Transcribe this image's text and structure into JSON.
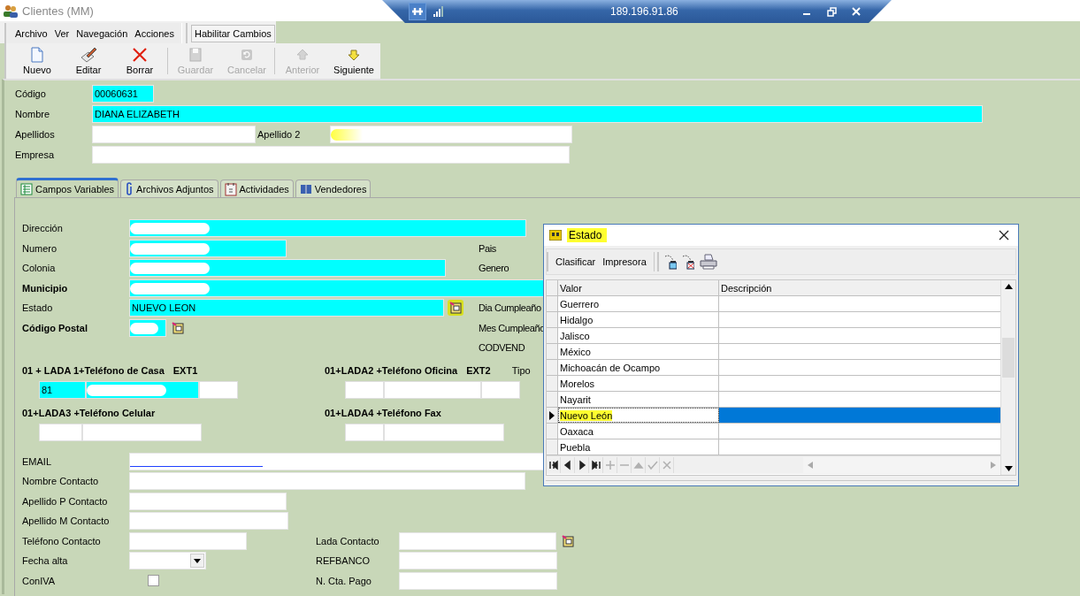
{
  "window": {
    "title": "Clientes (MM)"
  },
  "remote_bar": {
    "host": "189.196.91.86"
  },
  "menu": [
    "Archivo",
    "Ver",
    "Navegación",
    "Acciones"
  ],
  "enable_changes_button": "Habilitar Cambios",
  "toolbar": [
    {
      "label": "Nuevo",
      "disabled": false
    },
    {
      "label": "Editar",
      "disabled": false
    },
    {
      "label": "Borrar",
      "disabled": false
    },
    {
      "label": "Guardar",
      "disabled": true
    },
    {
      "label": "Cancelar",
      "disabled": true
    },
    {
      "label": "Anterior",
      "disabled": true
    },
    {
      "label": "Siguiente",
      "disabled": false
    }
  ],
  "header_fields": {
    "codigo": {
      "label": "Código",
      "value": "00060631",
      "highlighted": true
    },
    "nombre": {
      "label": "Nombre",
      "value": "DIANA ELIZABETH",
      "highlighted": true
    },
    "apellidos": {
      "label": "Apellidos",
      "second_label": "Apellido 2",
      "second_redacted": true
    },
    "empresa": {
      "label": "Empresa"
    }
  },
  "tabs": [
    {
      "label": "Campos Variables",
      "selected": true
    },
    {
      "label": "Archivos Adjuntos",
      "selected": false
    },
    {
      "label": "Actividades",
      "selected": false
    },
    {
      "label": "Vendedores",
      "selected": false
    }
  ],
  "address_fields": [
    {
      "label": "Dirección",
      "bold": false,
      "highlighted": true,
      "redacted": true,
      "lookup": false
    },
    {
      "label": "Numero",
      "bold": false,
      "highlighted": true,
      "redacted": true,
      "lookup": false
    },
    {
      "label": "Colonia",
      "bold": false,
      "highlighted": true,
      "redacted": true,
      "lookup": false
    },
    {
      "label": "Municipio",
      "bold": true,
      "highlighted": true,
      "redacted": true,
      "lookup": false
    },
    {
      "label": "Estado",
      "bold": false,
      "highlighted": true,
      "redacted": false,
      "value": "NUEVO LEON",
      "lookup": true,
      "lookup_highlighted": true
    },
    {
      "label": "Código Postal",
      "bold": true,
      "highlighted": true,
      "redacted": true,
      "lookup": true,
      "lookup_highlighted": false
    }
  ],
  "side_labels": [
    "Pais",
    "Genero",
    "Dia Cumpleaño",
    "Mes Cumpleaño",
    "CODVEND"
  ],
  "phone_groups": [
    {
      "labels": [
        "01 + LADA 1+Teléfono de Casa",
        "EXT1"
      ],
      "fields": [
        {
          "value": "81",
          "highlighted": true,
          "redacted": false
        },
        {
          "highlighted": true,
          "redacted": true
        },
        {
          "highlighted": false,
          "redacted": false
        }
      ]
    },
    {
      "labels": [
        "01+LADA2 +Teléfono Oficina",
        "EXT2",
        "Tipo"
      ],
      "fields": [
        {
          "highlighted": false,
          "redacted": false
        },
        {
          "highlighted": false,
          "redacted": false
        },
        {
          "highlighted": false,
          "redacted": false
        }
      ]
    },
    {
      "labels": [
        "01+LADA3 +Teléfono Celular"
      ],
      "fields": [
        {
          "highlighted": false,
          "redacted": false
        },
        {
          "highlighted": false,
          "redacted": false
        }
      ]
    },
    {
      "labels": [
        "01+LADA4  +Teléfono Fax"
      ],
      "fields": [
        {
          "highlighted": false,
          "redacted": false
        },
        {
          "highlighted": false,
          "redacted": false
        }
      ]
    }
  ],
  "contact_fields": [
    {
      "label": "EMAIL",
      "kind": "text",
      "redacted": true
    },
    {
      "label": "Nombre Contacto",
      "kind": "text",
      "redacted": false
    },
    {
      "label": "Apellido P Contacto",
      "kind": "text",
      "redacted": false
    },
    {
      "label": "Apellido M Contacto",
      "kind": "text",
      "redacted": false
    },
    {
      "label": "Teléfono Contacto",
      "kind": "text",
      "redacted": false
    },
    {
      "label": "Fecha alta",
      "kind": "dropdown"
    },
    {
      "label": "ConIVA",
      "kind": "checkbox",
      "checked": false
    }
  ],
  "bank_fields": [
    {
      "label": "Lada Contacto",
      "lookup": true
    },
    {
      "label": "REFBANCO",
      "lookup": false
    },
    {
      "label": "N. Cta. Pago",
      "lookup": false
    }
  ],
  "dialog": {
    "title": "Estado",
    "title_highlighted": true,
    "menu": [
      "Clasificar",
      "Impresora"
    ],
    "columns": [
      "Valor",
      "Descripción"
    ],
    "rows": [
      {
        "valor": "Guerrero",
        "selected": false,
        "highlighted": false
      },
      {
        "valor": "Hidalgo",
        "selected": false,
        "highlighted": false
      },
      {
        "valor": "Jalisco",
        "selected": false,
        "highlighted": false
      },
      {
        "valor": "México",
        "selected": false,
        "highlighted": false
      },
      {
        "valor": "Michoacán de Ocampo",
        "selected": false,
        "highlighted": false
      },
      {
        "valor": "Morelos",
        "selected": false,
        "highlighted": false
      },
      {
        "valor": "Nayarit",
        "selected": false,
        "highlighted": false
      },
      {
        "valor": "Nuevo León",
        "selected": true,
        "highlighted": true
      },
      {
        "valor": "Oaxaca",
        "selected": false,
        "highlighted": false
      },
      {
        "valor": "Puebla",
        "selected": false,
        "highlighted": false
      }
    ],
    "navigator": [
      {
        "kind": "first",
        "disabled": false
      },
      {
        "kind": "prior",
        "disabled": false
      },
      {
        "kind": "next",
        "disabled": false
      },
      {
        "kind": "last",
        "disabled": false
      },
      {
        "kind": "insert",
        "disabled": true
      },
      {
        "kind": "delete",
        "disabled": true
      },
      {
        "kind": "edit",
        "disabled": true
      },
      {
        "kind": "post",
        "disabled": true
      },
      {
        "kind": "cancel",
        "disabled": true
      }
    ]
  }
}
